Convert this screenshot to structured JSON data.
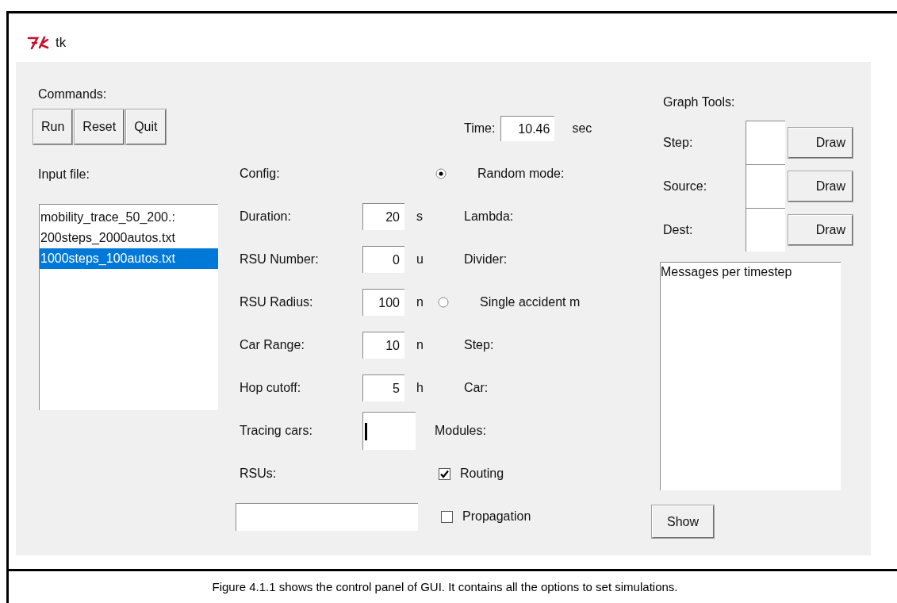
{
  "window": {
    "title": "tk"
  },
  "commands": {
    "label": "Commands:",
    "buttons": [
      "Run",
      "Reset",
      "Quit"
    ]
  },
  "input_file": {
    "label": "Input file:",
    "files": [
      {
        "name": "mobility_trace_50_200.:",
        "selected": false
      },
      {
        "name": "200steps_2000autos.txt",
        "selected": false
      },
      {
        "name": "1000steps_100autos.txt",
        "selected": true
      }
    ]
  },
  "time": {
    "label": "Time:",
    "value": "10.46",
    "unit": "sec"
  },
  "rows": [
    {
      "left": {
        "kind": "label",
        "text": "Config:"
      },
      "right": {
        "kind": "radio",
        "label": "Random mode:",
        "selected": true
      }
    },
    {
      "left": {
        "kind": "entry",
        "label": "Duration:",
        "value": "20",
        "unit": "s"
      },
      "right": {
        "kind": "label",
        "text": "Lambda:"
      }
    },
    {
      "left": {
        "kind": "entry",
        "label": "RSU Number:",
        "value": "0",
        "unit": "u"
      },
      "right": {
        "kind": "label",
        "text": "Divider:"
      }
    },
    {
      "left": {
        "kind": "entry",
        "label": "RSU Radius:",
        "value": "100",
        "unit": "n"
      },
      "right": {
        "kind": "radio",
        "label": "Single accident m",
        "selected": false
      }
    },
    {
      "left": {
        "kind": "entry",
        "label": "Car Range:",
        "value": "10",
        "unit": "n"
      },
      "right": {
        "kind": "label",
        "text": "Step:"
      }
    },
    {
      "left": {
        "kind": "entry",
        "label": "Hop cutoff:",
        "value": "5",
        "unit": "h"
      },
      "right": {
        "kind": "label",
        "text": "Car:"
      }
    },
    {
      "left": {
        "kind": "tall_entry",
        "label": "Tracing cars:",
        "focused": true
      },
      "right": {
        "kind": "heading",
        "text": "Modules:"
      }
    },
    {
      "left": {
        "kind": "label",
        "text": "RSUs:"
      },
      "right": {
        "kind": "checkbox",
        "label": "Routing",
        "checked": true
      }
    },
    {
      "left": {
        "kind": "wide_entry"
      },
      "right": {
        "kind": "checkbox",
        "label": "Propagation",
        "checked": false
      }
    }
  ],
  "graph_tools": {
    "title": "Graph Tools:",
    "rows": [
      {
        "label": "Step:",
        "button": "Draw"
      },
      {
        "label": "Source:",
        "button": "Draw"
      },
      {
        "label": "Dest:",
        "button": "Draw"
      }
    ],
    "messages": "Messages per timestep",
    "show_button": "Show"
  },
  "caption": "Figure 4.1.1 shows the control panel of GUI. It contains all the options to set simulations."
}
